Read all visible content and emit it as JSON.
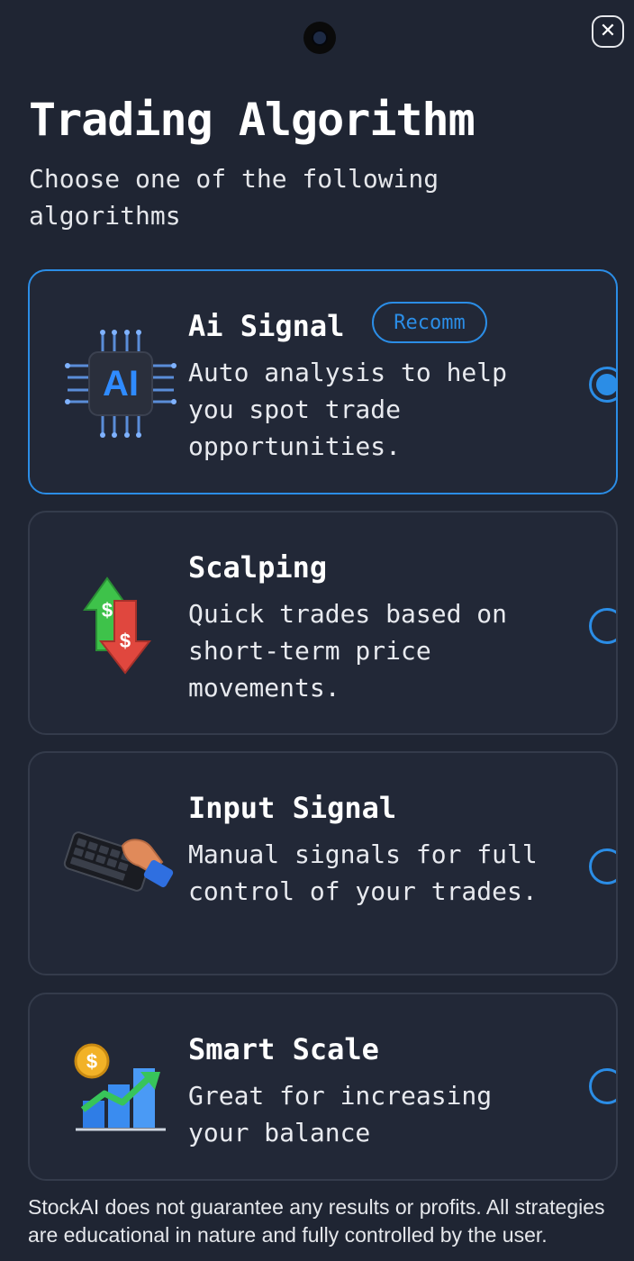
{
  "header": {
    "close_icon": "close-icon",
    "title": "Trading Algorithm",
    "subtitle": "Choose one of the following algorithms"
  },
  "algorithms": [
    {
      "name": "Ai Signal",
      "badge": "Recomm",
      "description": "Auto analysis to help you spot trade opportunities.",
      "icon": "ai-chip-icon",
      "icon_text": "AI",
      "selected": true
    },
    {
      "name": "Scalping",
      "description": "Quick trades based on short-term price movements.",
      "icon": "up-down-dollar-arrows-icon",
      "icon_text": "$",
      "selected": false
    },
    {
      "name": "Input Signal",
      "description": "Manual signals for full control of your trades.",
      "icon": "hand-keyboard-icon",
      "selected": false
    },
    {
      "name": "Smart Scale",
      "description": "Great for increasing your balance",
      "icon": "coin-growth-chart-icon",
      "icon_text": "$",
      "selected": false
    }
  ],
  "disclaimer": "StockAI does not guarantee any results or profits. All strategies are educational in nature and fully controlled by the user.",
  "colors": {
    "background": "#1f2533",
    "card_border": "#343b4b",
    "accent": "#2b8de6"
  }
}
